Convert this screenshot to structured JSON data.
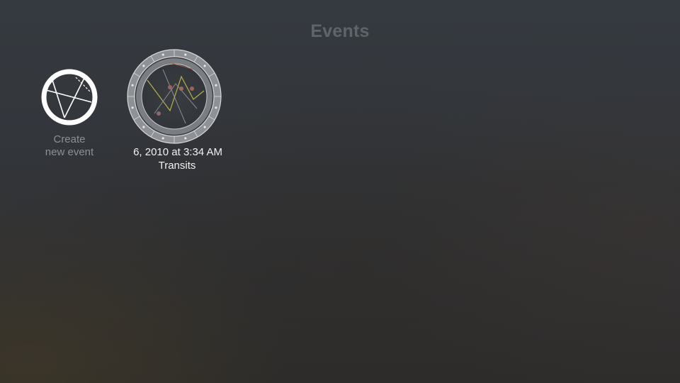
{
  "page": {
    "title": "Events"
  },
  "create_tile": {
    "line1": "Create",
    "line2": "new event",
    "icon": "chart-outline-icon"
  },
  "events": [
    {
      "date": "6, 2010 at 3:34 AM",
      "type": "Transits",
      "icon": "astrology-chart-wheel-icon"
    }
  ],
  "colors": {
    "title": "#5f646b",
    "create_label": "#8d9096",
    "event_text": "#f2f2f2",
    "icon_white": "#ffffff"
  }
}
